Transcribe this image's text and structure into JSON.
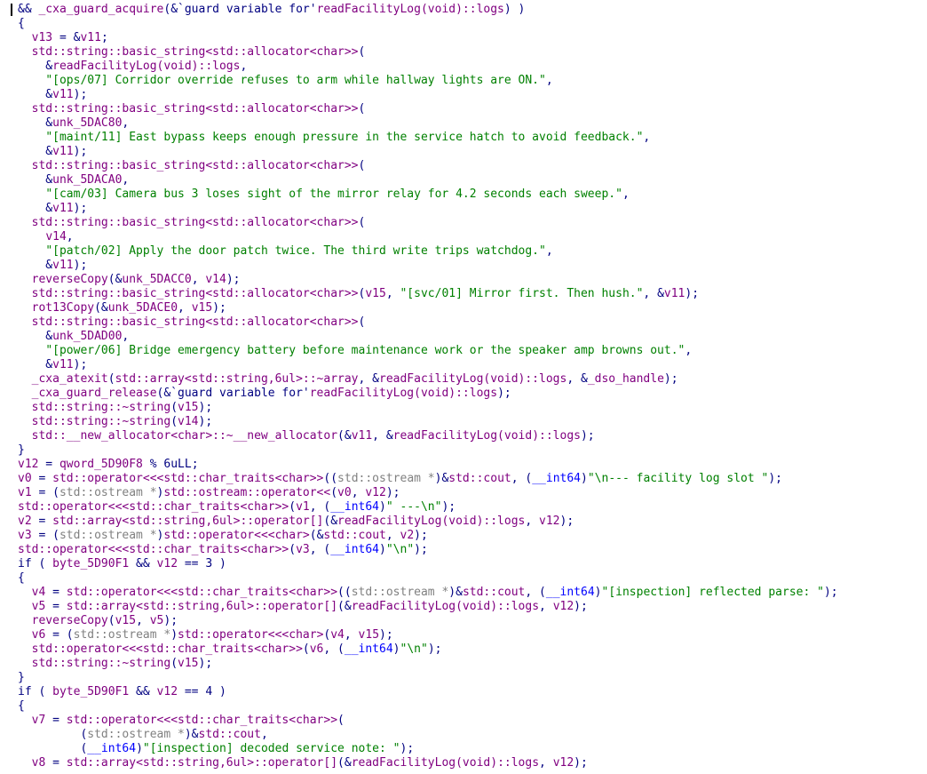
{
  "colors": {
    "plain": "#000080",
    "type": "#0000ff",
    "comment_gray": "#808080",
    "identifier": "#800080",
    "string": "#008000",
    "literal": "#000080",
    "background": "#ffffff"
  },
  "lines": [
    [
      [
        "pl",
        "&& "
      ],
      [
        "id",
        "_cxa_guard_acquire"
      ],
      [
        "pl",
        "(&`guard variable for'"
      ],
      [
        "id",
        "readFacilityLog(void)::logs"
      ],
      [
        "pl",
        ") )"
      ]
    ],
    [
      [
        "pl",
        "{"
      ]
    ],
    [
      [
        "pl",
        "  "
      ],
      [
        "id",
        "v13"
      ],
      [
        "pl",
        " = &"
      ],
      [
        "id",
        "v11"
      ],
      [
        "pl",
        ";"
      ]
    ],
    [
      [
        "pl",
        "  "
      ],
      [
        "id",
        "std::string::basic_string<std::allocator<char>>"
      ],
      [
        "pl",
        "("
      ]
    ],
    [
      [
        "pl",
        "    &"
      ],
      [
        "id",
        "readFacilityLog(void)::logs"
      ],
      [
        "pl",
        ","
      ]
    ],
    [
      [
        "pl",
        "    "
      ],
      [
        "str",
        "\"[ops/07] Corridor override refuses to arm while hallway lights are ON.\""
      ],
      [
        "pl",
        ","
      ]
    ],
    [
      [
        "pl",
        "    &"
      ],
      [
        "id",
        "v11"
      ],
      [
        "pl",
        ");"
      ]
    ],
    [
      [
        "pl",
        "  "
      ],
      [
        "id",
        "std::string::basic_string<std::allocator<char>>"
      ],
      [
        "pl",
        "("
      ]
    ],
    [
      [
        "pl",
        "    &"
      ],
      [
        "id",
        "unk_5DAC80"
      ],
      [
        "pl",
        ","
      ]
    ],
    [
      [
        "pl",
        "    "
      ],
      [
        "str",
        "\"[maint/11] East bypass keeps enough pressure in the service hatch to avoid feedback.\""
      ],
      [
        "pl",
        ","
      ]
    ],
    [
      [
        "pl",
        "    &"
      ],
      [
        "id",
        "v11"
      ],
      [
        "pl",
        ");"
      ]
    ],
    [
      [
        "pl",
        "  "
      ],
      [
        "id",
        "std::string::basic_string<std::allocator<char>>"
      ],
      [
        "pl",
        "("
      ]
    ],
    [
      [
        "pl",
        "    &"
      ],
      [
        "id",
        "unk_5DACA0"
      ],
      [
        "pl",
        ","
      ]
    ],
    [
      [
        "pl",
        "    "
      ],
      [
        "str",
        "\"[cam/03] Camera bus 3 loses sight of the mirror relay for 4.2 seconds each sweep.\""
      ],
      [
        "pl",
        ","
      ]
    ],
    [
      [
        "pl",
        "    &"
      ],
      [
        "id",
        "v11"
      ],
      [
        "pl",
        ");"
      ]
    ],
    [
      [
        "pl",
        "  "
      ],
      [
        "id",
        "std::string::basic_string<std::allocator<char>>"
      ],
      [
        "pl",
        "("
      ]
    ],
    [
      [
        "pl",
        "    "
      ],
      [
        "id",
        "v14"
      ],
      [
        "pl",
        ","
      ]
    ],
    [
      [
        "pl",
        "    "
      ],
      [
        "str",
        "\"[patch/02] Apply the door patch twice. The third write trips watchdog.\""
      ],
      [
        "pl",
        ","
      ]
    ],
    [
      [
        "pl",
        "    &"
      ],
      [
        "id",
        "v11"
      ],
      [
        "pl",
        ");"
      ]
    ],
    [
      [
        "pl",
        "  "
      ],
      [
        "id",
        "reverseCopy"
      ],
      [
        "pl",
        "(&"
      ],
      [
        "id",
        "unk_5DACC0"
      ],
      [
        "pl",
        ", "
      ],
      [
        "id",
        "v14"
      ],
      [
        "pl",
        ");"
      ]
    ],
    [
      [
        "pl",
        "  "
      ],
      [
        "id",
        "std::string::basic_string<std::allocator<char>>"
      ],
      [
        "pl",
        "("
      ],
      [
        "id",
        "v15"
      ],
      [
        "pl",
        ", "
      ],
      [
        "str",
        "\"[svc/01] Mirror first. Then hush.\""
      ],
      [
        "pl",
        ", &"
      ],
      [
        "id",
        "v11"
      ],
      [
        "pl",
        ");"
      ]
    ],
    [
      [
        "pl",
        "  "
      ],
      [
        "id",
        "rot13Copy"
      ],
      [
        "pl",
        "(&"
      ],
      [
        "id",
        "unk_5DACE0"
      ],
      [
        "pl",
        ", "
      ],
      [
        "id",
        "v15"
      ],
      [
        "pl",
        ");"
      ]
    ],
    [
      [
        "pl",
        "  "
      ],
      [
        "id",
        "std::string::basic_string<std::allocator<char>>"
      ],
      [
        "pl",
        "("
      ]
    ],
    [
      [
        "pl",
        "    &"
      ],
      [
        "id",
        "unk_5DAD00"
      ],
      [
        "pl",
        ","
      ]
    ],
    [
      [
        "pl",
        "    "
      ],
      [
        "str",
        "\"[power/06] Bridge emergency battery before maintenance work or the speaker amp browns out.\""
      ],
      [
        "pl",
        ","
      ]
    ],
    [
      [
        "pl",
        "    &"
      ],
      [
        "id",
        "v11"
      ],
      [
        "pl",
        ");"
      ]
    ],
    [
      [
        "pl",
        "  "
      ],
      [
        "id",
        "_cxa_atexit"
      ],
      [
        "pl",
        "("
      ],
      [
        "id",
        "std::array<std::string,6ul>::~array"
      ],
      [
        "pl",
        ", &"
      ],
      [
        "id",
        "readFacilityLog(void)::logs"
      ],
      [
        "pl",
        ", &"
      ],
      [
        "id",
        "_dso_handle"
      ],
      [
        "pl",
        ");"
      ]
    ],
    [
      [
        "pl",
        "  "
      ],
      [
        "id",
        "_cxa_guard_release"
      ],
      [
        "pl",
        "(&`guard variable for'"
      ],
      [
        "id",
        "readFacilityLog(void)::logs"
      ],
      [
        "pl",
        ");"
      ]
    ],
    [
      [
        "pl",
        "  "
      ],
      [
        "id",
        "std::string::~string"
      ],
      [
        "pl",
        "("
      ],
      [
        "id",
        "v15"
      ],
      [
        "pl",
        ");"
      ]
    ],
    [
      [
        "pl",
        "  "
      ],
      [
        "id",
        "std::string::~string"
      ],
      [
        "pl",
        "("
      ],
      [
        "id",
        "v14"
      ],
      [
        "pl",
        ");"
      ]
    ],
    [
      [
        "pl",
        "  "
      ],
      [
        "id",
        "std::__new_allocator<char>::~__new_allocator"
      ],
      [
        "pl",
        "(&"
      ],
      [
        "id",
        "v11"
      ],
      [
        "pl",
        ", &"
      ],
      [
        "id",
        "readFacilityLog(void)::logs"
      ],
      [
        "pl",
        ");"
      ]
    ],
    [
      [
        "pl",
        "}"
      ]
    ],
    [
      [
        "id",
        "v12"
      ],
      [
        "pl",
        " = "
      ],
      [
        "id",
        "qword_5D90F8"
      ],
      [
        "pl",
        " % "
      ],
      [
        "lit",
        "6uLL"
      ],
      [
        "pl",
        ";"
      ]
    ],
    [
      [
        "id",
        "v0"
      ],
      [
        "pl",
        " = "
      ],
      [
        "id",
        "std::operator<<<std::char_traits<char>>"
      ],
      [
        "pl",
        "(("
      ],
      [
        "cm",
        "std::ostream *"
      ],
      [
        "pl",
        ")&"
      ],
      [
        "id",
        "std::cout"
      ],
      [
        "pl",
        ", ("
      ],
      [
        "tp",
        "__int64"
      ],
      [
        "pl",
        ")"
      ],
      [
        "str",
        "\"\\n--- facility log slot \""
      ],
      [
        "pl",
        ");"
      ]
    ],
    [
      [
        "id",
        "v1"
      ],
      [
        "pl",
        " = ("
      ],
      [
        "cm",
        "std::ostream *"
      ],
      [
        "pl",
        ")"
      ],
      [
        "id",
        "std::ostream::operator<<"
      ],
      [
        "pl",
        "("
      ],
      [
        "id",
        "v0"
      ],
      [
        "pl",
        ", "
      ],
      [
        "id",
        "v12"
      ],
      [
        "pl",
        ");"
      ]
    ],
    [
      [
        "id",
        "std::operator<<<std::char_traits<char>>"
      ],
      [
        "pl",
        "("
      ],
      [
        "id",
        "v1"
      ],
      [
        "pl",
        ", ("
      ],
      [
        "tp",
        "__int64"
      ],
      [
        "pl",
        ")"
      ],
      [
        "str",
        "\" ---\\n\""
      ],
      [
        "pl",
        ");"
      ]
    ],
    [
      [
        "id",
        "v2"
      ],
      [
        "pl",
        " = "
      ],
      [
        "id",
        "std::array<std::string,6ul>::operator[]"
      ],
      [
        "pl",
        "(&"
      ],
      [
        "id",
        "readFacilityLog(void)::logs"
      ],
      [
        "pl",
        ", "
      ],
      [
        "id",
        "v12"
      ],
      [
        "pl",
        ");"
      ]
    ],
    [
      [
        "id",
        "v3"
      ],
      [
        "pl",
        " = ("
      ],
      [
        "cm",
        "std::ostream *"
      ],
      [
        "pl",
        ")"
      ],
      [
        "id",
        "std::operator<<<char>"
      ],
      [
        "pl",
        "(&"
      ],
      [
        "id",
        "std::cout"
      ],
      [
        "pl",
        ", "
      ],
      [
        "id",
        "v2"
      ],
      [
        "pl",
        ");"
      ]
    ],
    [
      [
        "id",
        "std::operator<<<std::char_traits<char>>"
      ],
      [
        "pl",
        "("
      ],
      [
        "id",
        "v3"
      ],
      [
        "pl",
        ", ("
      ],
      [
        "tp",
        "__int64"
      ],
      [
        "pl",
        ")"
      ],
      [
        "str",
        "\"\\n\""
      ],
      [
        "pl",
        ");"
      ]
    ],
    [
      [
        "pl",
        "if ( "
      ],
      [
        "id",
        "byte_5D90F1"
      ],
      [
        "pl",
        " && "
      ],
      [
        "id",
        "v12"
      ],
      [
        "pl",
        " == "
      ],
      [
        "lit",
        "3"
      ],
      [
        "pl",
        " )"
      ]
    ],
    [
      [
        "pl",
        "{"
      ]
    ],
    [
      [
        "pl",
        "  "
      ],
      [
        "id",
        "v4"
      ],
      [
        "pl",
        " = "
      ],
      [
        "id",
        "std::operator<<<std::char_traits<char>>"
      ],
      [
        "pl",
        "(("
      ],
      [
        "cm",
        "std::ostream *"
      ],
      [
        "pl",
        ")&"
      ],
      [
        "id",
        "std::cout"
      ],
      [
        "pl",
        ", ("
      ],
      [
        "tp",
        "__int64"
      ],
      [
        "pl",
        ")"
      ],
      [
        "str",
        "\"[inspection] reflected parse: \""
      ],
      [
        "pl",
        ");"
      ]
    ],
    [
      [
        "pl",
        "  "
      ],
      [
        "id",
        "v5"
      ],
      [
        "pl",
        " = "
      ],
      [
        "id",
        "std::array<std::string,6ul>::operator[]"
      ],
      [
        "pl",
        "(&"
      ],
      [
        "id",
        "readFacilityLog(void)::logs"
      ],
      [
        "pl",
        ", "
      ],
      [
        "id",
        "v12"
      ],
      [
        "pl",
        ");"
      ]
    ],
    [
      [
        "pl",
        "  "
      ],
      [
        "id",
        "reverseCopy"
      ],
      [
        "pl",
        "("
      ],
      [
        "id",
        "v15"
      ],
      [
        "pl",
        ", "
      ],
      [
        "id",
        "v5"
      ],
      [
        "pl",
        ");"
      ]
    ],
    [
      [
        "pl",
        "  "
      ],
      [
        "id",
        "v6"
      ],
      [
        "pl",
        " = ("
      ],
      [
        "cm",
        "std::ostream *"
      ],
      [
        "pl",
        ")"
      ],
      [
        "id",
        "std::operator<<<char>"
      ],
      [
        "pl",
        "("
      ],
      [
        "id",
        "v4"
      ],
      [
        "pl",
        ", "
      ],
      [
        "id",
        "v15"
      ],
      [
        "pl",
        ");"
      ]
    ],
    [
      [
        "pl",
        "  "
      ],
      [
        "id",
        "std::operator<<<std::char_traits<char>>"
      ],
      [
        "pl",
        "("
      ],
      [
        "id",
        "v6"
      ],
      [
        "pl",
        ", ("
      ],
      [
        "tp",
        "__int64"
      ],
      [
        "pl",
        ")"
      ],
      [
        "str",
        "\"\\n\""
      ],
      [
        "pl",
        ");"
      ]
    ],
    [
      [
        "pl",
        "  "
      ],
      [
        "id",
        "std::string::~string"
      ],
      [
        "pl",
        "("
      ],
      [
        "id",
        "v15"
      ],
      [
        "pl",
        ");"
      ]
    ],
    [
      [
        "pl",
        "}"
      ]
    ],
    [
      [
        "pl",
        "if ( "
      ],
      [
        "id",
        "byte_5D90F1"
      ],
      [
        "pl",
        " && "
      ],
      [
        "id",
        "v12"
      ],
      [
        "pl",
        " == "
      ],
      [
        "lit",
        "4"
      ],
      [
        "pl",
        " )"
      ]
    ],
    [
      [
        "pl",
        "{"
      ]
    ],
    [
      [
        "pl",
        "  "
      ],
      [
        "id",
        "v7"
      ],
      [
        "pl",
        " = "
      ],
      [
        "id",
        "std::operator<<<std::char_traits<char>>"
      ],
      [
        "pl",
        "("
      ]
    ],
    [
      [
        "pl",
        "         ("
      ],
      [
        "cm",
        "std::ostream *"
      ],
      [
        "pl",
        ")&"
      ],
      [
        "id",
        "std::cout"
      ],
      [
        "pl",
        ","
      ]
    ],
    [
      [
        "pl",
        "         ("
      ],
      [
        "tp",
        "__int64"
      ],
      [
        "pl",
        ")"
      ],
      [
        "str",
        "\"[inspection] decoded service note: \""
      ],
      [
        "pl",
        ");"
      ]
    ],
    [
      [
        "pl",
        "  "
      ],
      [
        "id",
        "v8"
      ],
      [
        "pl",
        " = "
      ],
      [
        "id",
        "std::array<std::string,6ul>::operator[]"
      ],
      [
        "pl",
        "(&"
      ],
      [
        "id",
        "readFacilityLog(void)::logs"
      ],
      [
        "pl",
        ", "
      ],
      [
        "id",
        "v12"
      ],
      [
        "pl",
        ");"
      ]
    ]
  ]
}
